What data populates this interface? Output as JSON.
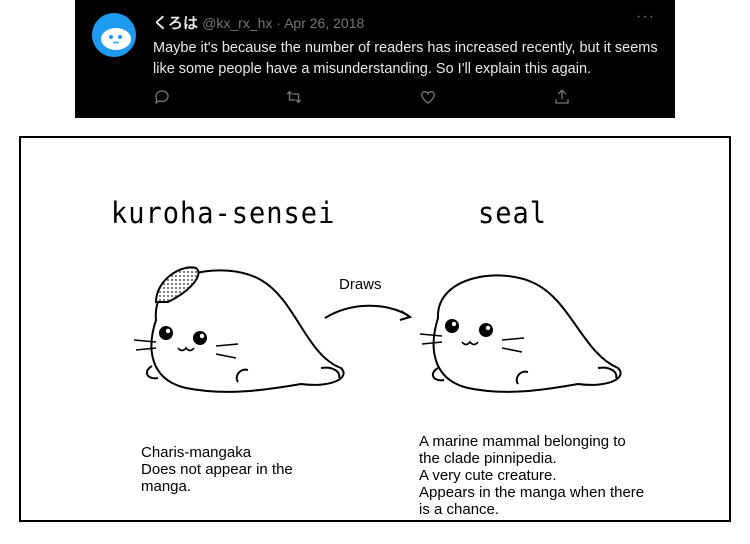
{
  "tweet": {
    "display_name": "くろは",
    "handle": "@kx_rx_hx",
    "separator": " · ",
    "date": "Apr 26, 2018",
    "more_label": "···",
    "text": "Maybe it's because the number of readers has increased recently, but it seems like some people have a misunderstanding. So I'll explain this again.",
    "actions": [
      {
        "icon": "reply-icon"
      },
      {
        "icon": "retweet-icon"
      },
      {
        "icon": "like-icon"
      },
      {
        "icon": "share-icon"
      }
    ],
    "colors": {
      "background": "#000000",
      "text": "#e7e9ea",
      "muted": "#71767b",
      "avatar": "#1d9bf0"
    }
  },
  "comic": {
    "left_title": "kuroha-sensei",
    "right_title": "seal",
    "arrow_label": "Draws",
    "left_caption": [
      "Charis-mangaka",
      "Does not appear in the",
      "manga."
    ],
    "right_caption": [
      "A marine mammal belonging to",
      "the clade pinnipedia.",
      "A very cute creature.",
      "Appears in the manga when there",
      "is a chance."
    ]
  }
}
